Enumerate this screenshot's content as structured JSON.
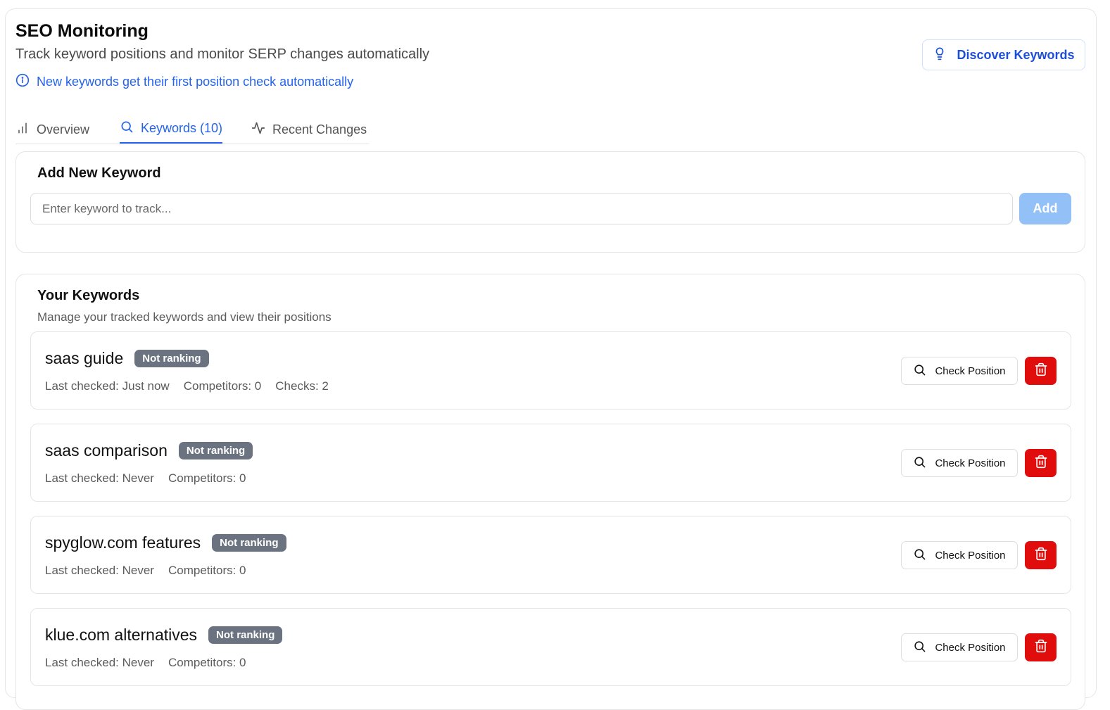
{
  "header": {
    "title": "SEO Monitoring",
    "subtitle": "Track keyword positions and monitor SERP changes automatically",
    "info_text": "New keywords get their first position check automatically",
    "discover_label": "Discover Keywords"
  },
  "tabs": [
    {
      "label": "Overview",
      "icon": "bar-chart-icon",
      "active": false
    },
    {
      "label": "Keywords (10)",
      "icon": "search-icon",
      "active": true
    },
    {
      "label": "Recent Changes",
      "icon": "activity-icon",
      "active": false
    }
  ],
  "add_keyword": {
    "title": "Add New Keyword",
    "placeholder": "Enter keyword to track...",
    "value": "",
    "add_label": "Add"
  },
  "keywords_section": {
    "title": "Your Keywords",
    "subtitle": "Manage your tracked keywords and view their positions",
    "check_label": "Check Position",
    "items": [
      {
        "name": "saas guide",
        "badge": "Not ranking",
        "last_checked": "Last checked: Just now",
        "competitors": "Competitors: 0",
        "checks": "Checks: 2"
      },
      {
        "name": "saas comparison",
        "badge": "Not ranking",
        "last_checked": "Last checked: Never",
        "competitors": "Competitors: 0"
      },
      {
        "name": "spyglow.com features",
        "badge": "Not ranking",
        "last_checked": "Last checked: Never",
        "competitors": "Competitors: 0"
      },
      {
        "name": "klue.com alternatives",
        "badge": "Not ranking",
        "last_checked": "Last checked: Never",
        "competitors": "Competitors: 0"
      }
    ]
  },
  "colors": {
    "accent": "#2563eb",
    "badge_bg": "#6b7280",
    "delete_bg": "#e10d0d",
    "add_disabled_bg": "#93c0f6"
  }
}
